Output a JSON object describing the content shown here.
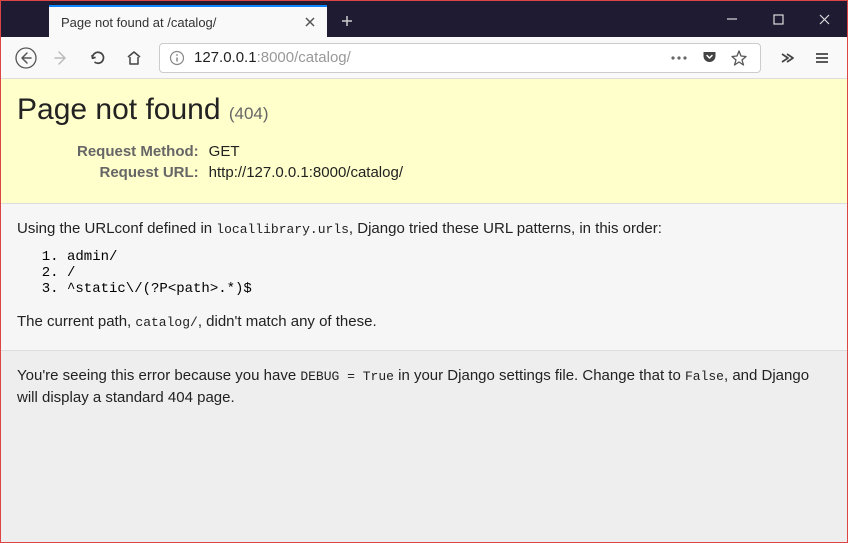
{
  "tab": {
    "title": "Page not found at /catalog/"
  },
  "url": {
    "prefix": "127.0.0.1",
    "suffix": ":8000/catalog/"
  },
  "summary": {
    "title": "Page not found ",
    "code": "(404)",
    "method_label": "Request Method:",
    "method_val": "GET",
    "url_label": "Request URL:",
    "url_val": "http://127.0.0.1:8000/catalog/"
  },
  "info": {
    "intro_1": "Using the URLconf defined in ",
    "intro_code": "locallibrary.urls",
    "intro_2": ", Django tried these URL patterns, in this order:",
    "patterns": [
      "admin/",
      "/",
      "^static\\/(?P<path>.*)$"
    ],
    "nomatch_1": "The current path, ",
    "nomatch_code": "catalog/",
    "nomatch_2": ", didn't match any of these."
  },
  "explanation": {
    "text_1": "You're seeing this error because you have ",
    "code_1": "DEBUG = True",
    "text_2": " in your Django settings file. Change that to ",
    "code_2": "False",
    "text_3": ", and Django will display a standard 404 page."
  }
}
